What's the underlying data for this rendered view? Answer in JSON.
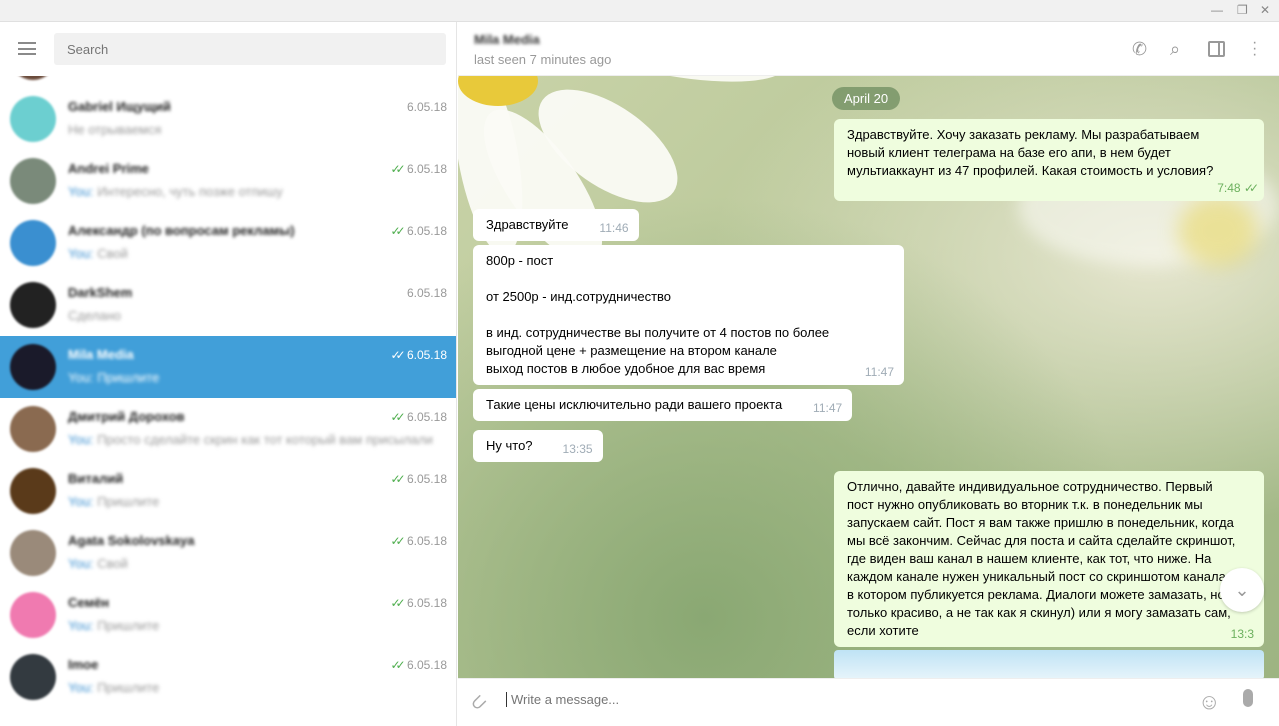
{
  "window": {
    "controls": [
      "minimize",
      "restore",
      "close"
    ]
  },
  "sidebar": {
    "search_placeholder": "Search",
    "chats": [
      {
        "name": "Gabriel Ищущий",
        "preview": "Не отрываемся",
        "date": "6.05.18",
        "read": false,
        "avatar": "#6ccfd0"
      },
      {
        "name": "Andrei Prime",
        "preview_prefix": "You:",
        "preview": "Интересно, чуть позже отпишу",
        "date": "6.05.18",
        "read": true,
        "avatar": "#7a8a7a"
      },
      {
        "name": "Александр (по вопросам рекламы)",
        "preview_prefix": "You:",
        "preview": "Свой",
        "date": "6.05.18",
        "read": true,
        "avatar": "#3a8fd0"
      },
      {
        "name": "DarkShem",
        "preview": "Сделано",
        "date": "6.05.18",
        "read": false,
        "avatar": "#222222"
      },
      {
        "name": "Mila Media",
        "preview_prefix": "You:",
        "preview": "Пришлите",
        "date": "6.05.18",
        "read": true,
        "avatar": "#1a1a2a",
        "selected": true
      },
      {
        "name": "Дмитрий Дорохов",
        "preview_prefix": "You:",
        "preview": "Просто сделайте скрин как тот который вам присылали",
        "date": "6.05.18",
        "read": true,
        "avatar": "#8a6a50"
      },
      {
        "name": "Виталий",
        "preview_prefix": "You:",
        "preview": "Пришлите",
        "date": "6.05.18",
        "read": true,
        "avatar": "#5a3a1a"
      },
      {
        "name": "Agata Sokolovskaya",
        "preview_prefix": "You:",
        "preview": "Свой",
        "date": "6.05.18",
        "read": true,
        "avatar": "#9a8a7a"
      },
      {
        "name": "Семён",
        "preview_prefix": "You:",
        "preview": "Пришлите",
        "date": "6.05.18",
        "read": true,
        "avatar": "#f07ab0"
      },
      {
        "name": "Imoe",
        "preview_prefix": "You:",
        "preview": "Пришлите",
        "date": "6.05.18",
        "read": true,
        "avatar": "#333a40"
      }
    ]
  },
  "chat": {
    "name": "Mila Media",
    "status": "last seen 7 minutes ago",
    "date_pill": "April 20",
    "messages": [
      {
        "dir": "out",
        "text": "Здравствуйте. Хочу заказать рекламу. Мы разрабатываем\nновый клиент телеграма на базе его апи, в нем будет\nмультиаккаунт из 47 профилей. Какая стоимость и условия?",
        "time": "7:48",
        "read": true
      },
      {
        "dir": "in",
        "text": "Здравствуйте",
        "time": "11:46"
      },
      {
        "dir": "in",
        "text": "800р - пост\n\nот 2500р - инд.сотрудничество\n\nв инд. сотрудничестве вы получите от 4 постов по более\nвыгодной цене + размещение на втором канале\nвыход постов в любое удобное для вас время",
        "time": "11:47"
      },
      {
        "dir": "in",
        "text": "Такие цены исключительно ради вашего проекта",
        "time": "11:47"
      },
      {
        "dir": "in",
        "text": "Ну что?",
        "time": "13:35"
      },
      {
        "dir": "out",
        "text": "Отлично, давайте индивидуальное сотрудничество. Первый\nпост нужно опубликовать во вторник т.к. в понедельник мы\nзапускаем сайт. Пост я вам также пришлю в понедельник, когда\nмы всё закончим. Сейчас для поста и сайта сделайте скриншот,\nгде виден ваш канал в нашем клиенте, как тот, что ниже. На\nкаждом канале нужен уникальный пост со скриншотом канала,\nв котором публикуется реклама. Диалоги можете замазать, но\nтолько красиво, а не так как я скинул) или я могу замазать сам,\nесли хотите",
        "time": "13:3"
      }
    ],
    "composer_placeholder": "Write a message...",
    "accent": "#419fd9"
  }
}
